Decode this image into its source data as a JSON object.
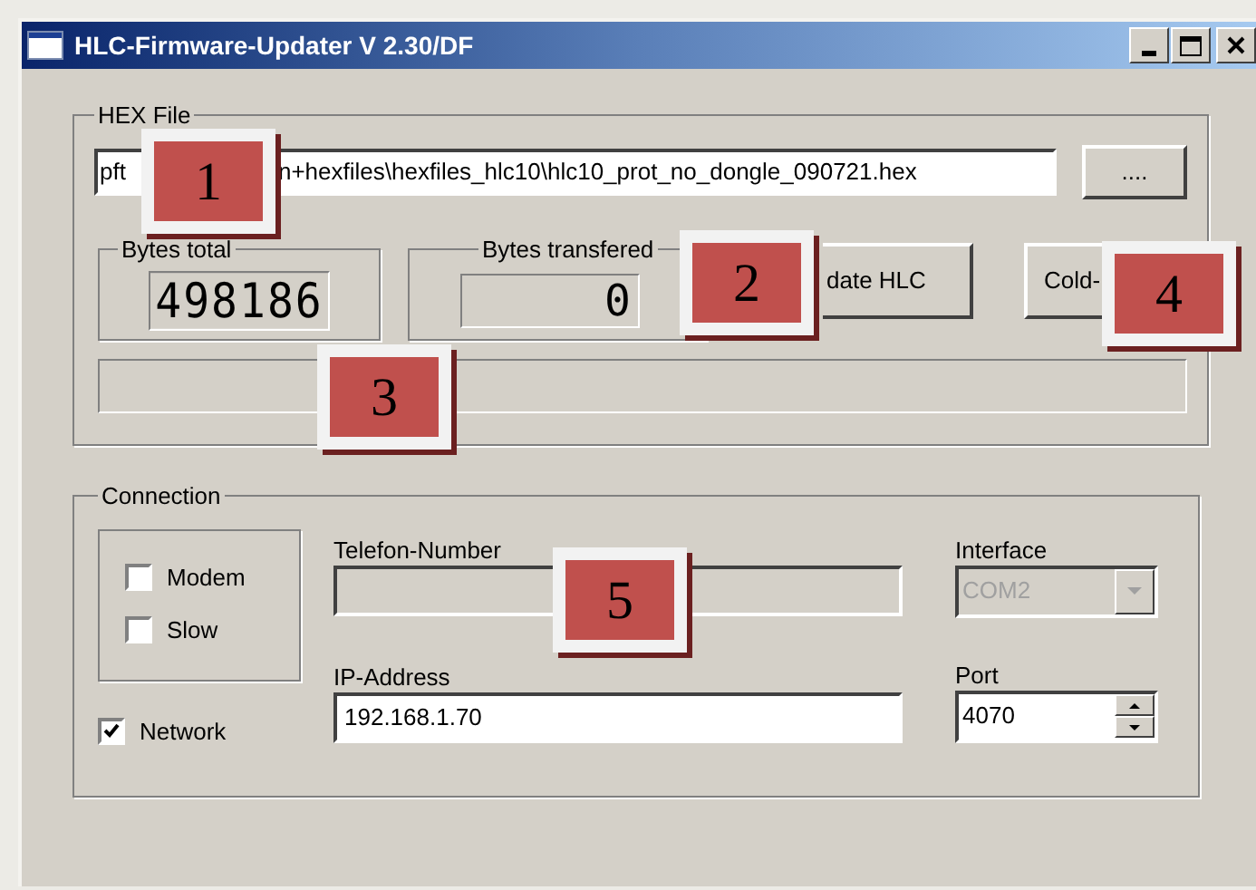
{
  "window": {
    "title": "HLC-Firmware-Updater V 2.30/DF"
  },
  "hex_file": {
    "title": "HEX File",
    "path_start": "pft",
    "path_end": "n+hexfiles\\hexfiles_hlc10\\hlc10_prot_no_dongle_090721.hex",
    "browse_button": "....",
    "bytes_total": {
      "label": "Bytes total",
      "value": "498186"
    },
    "bytes_transferred": {
      "label": "Bytes transfered",
      "value": "0"
    },
    "update_button": "date HLC",
    "cold_button": "Cold-",
    "progress": {
      "level": 0
    }
  },
  "connection": {
    "title": "Connection",
    "options": [
      {
        "label": "Modem",
        "checked": false
      },
      {
        "label": "Slow",
        "checked": false
      }
    ],
    "network": {
      "label": "Network",
      "checked": true
    },
    "telefon": {
      "label": "Telefon-Number"
    },
    "ip": {
      "label": "IP-Address",
      "value": "192.168.1.70"
    },
    "interface": {
      "label": "Interface",
      "value": "COM2",
      "disabled": true
    },
    "port": {
      "label": "Port",
      "value": "4070"
    }
  },
  "callouts": [
    {
      "label": "1"
    },
    {
      "label": "2"
    },
    {
      "label": "3"
    },
    {
      "label": "4"
    },
    {
      "label": "5"
    }
  ]
}
